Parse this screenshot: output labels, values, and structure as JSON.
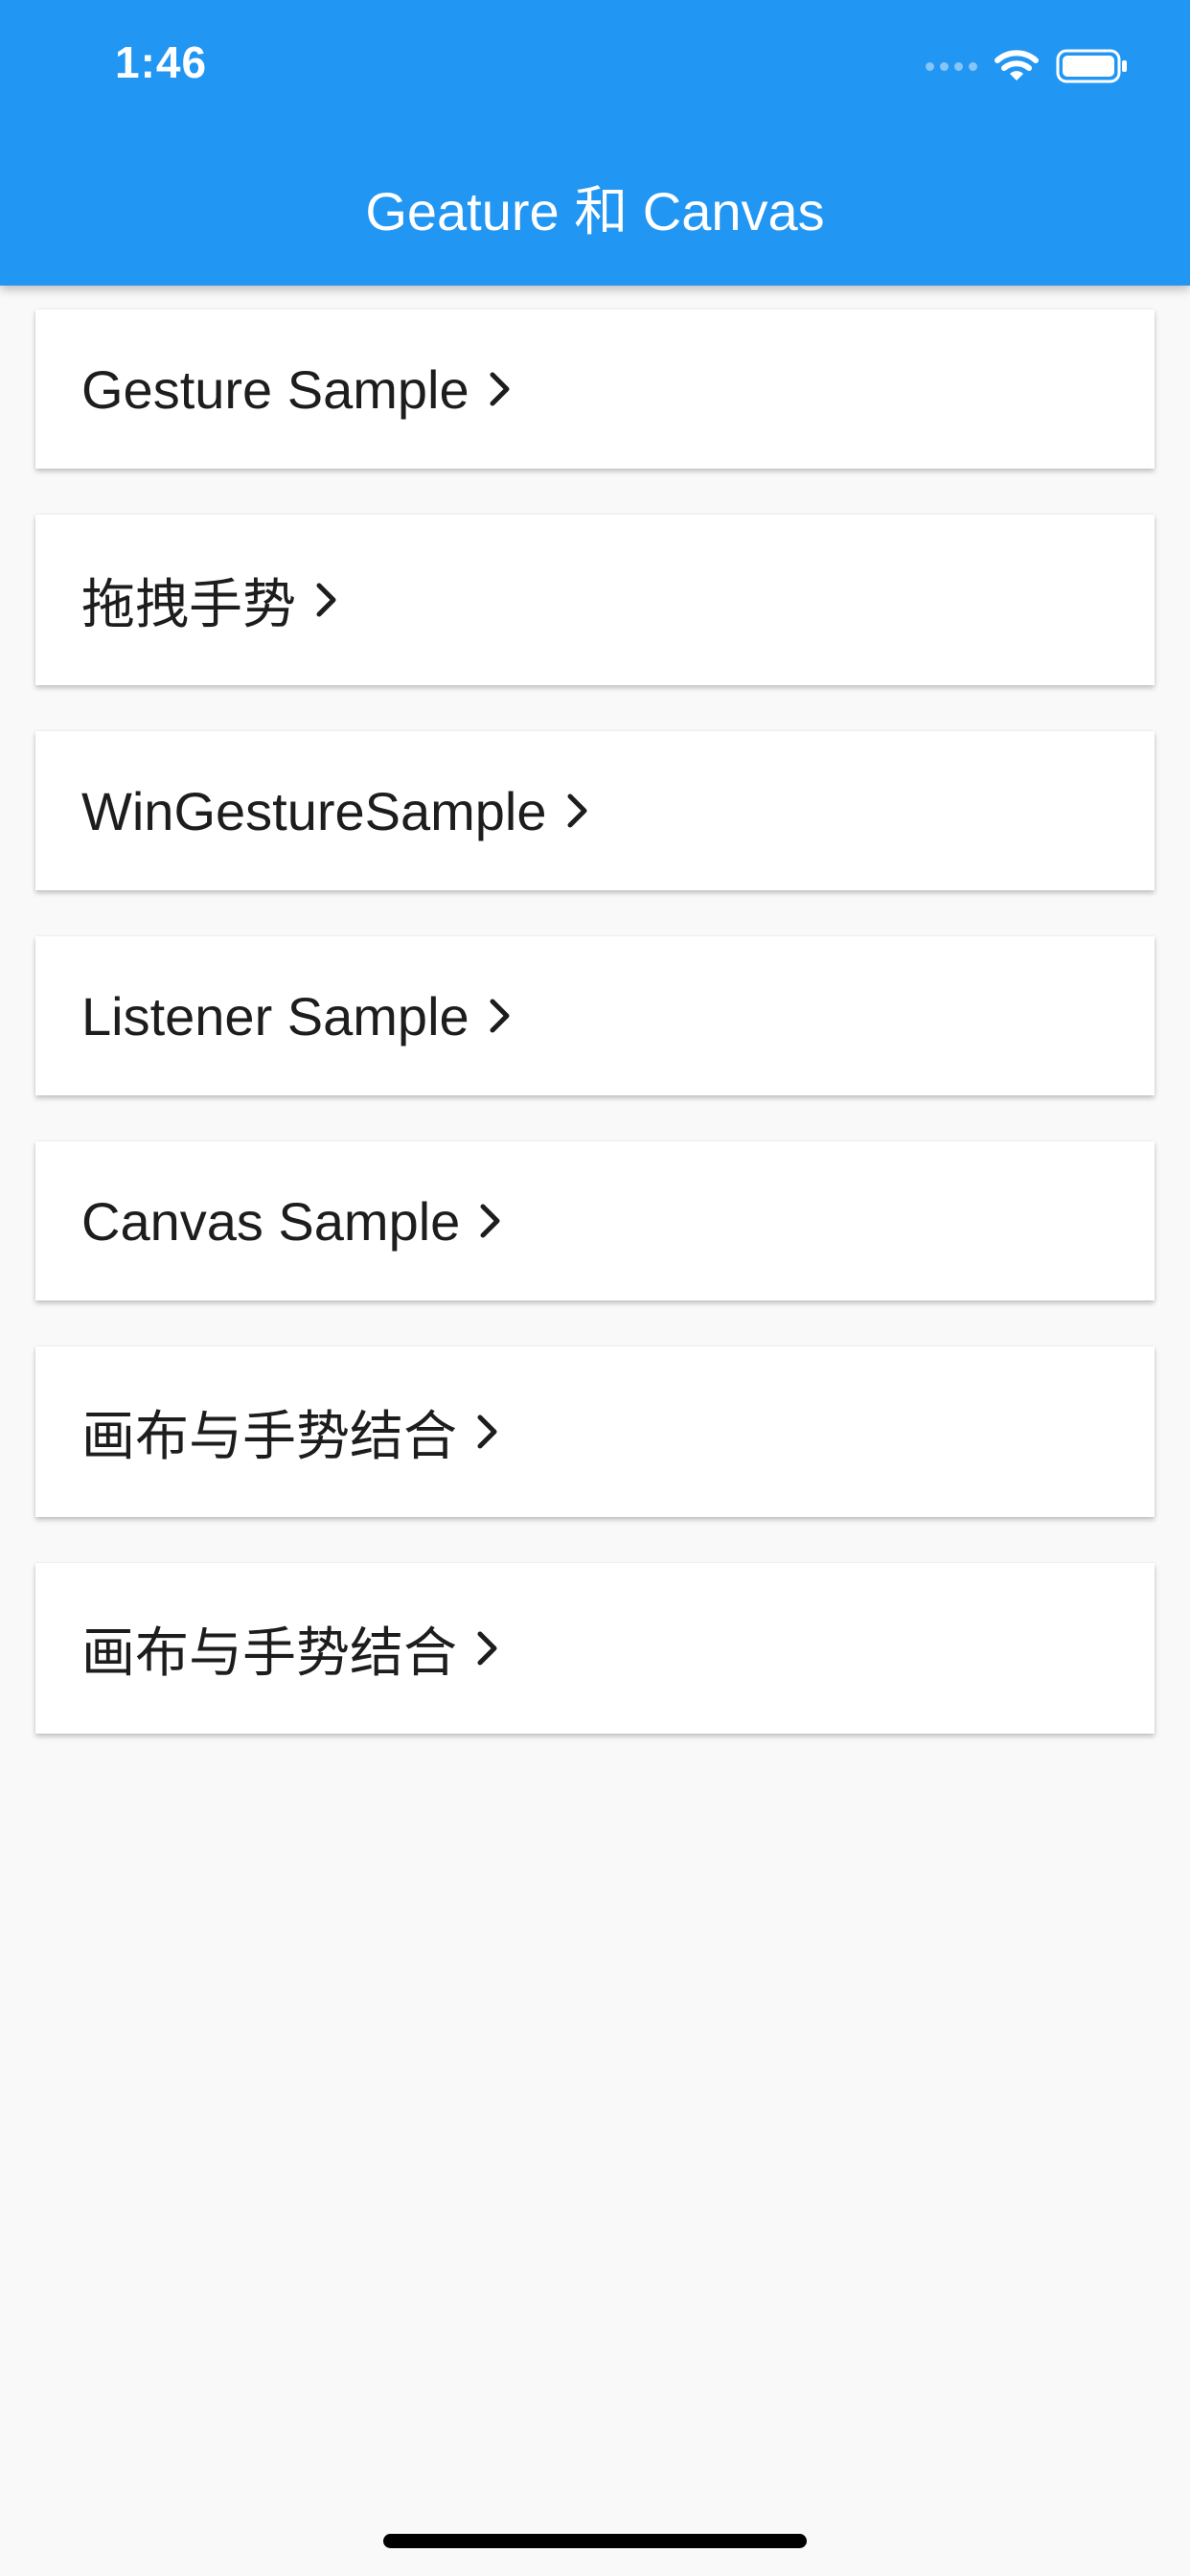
{
  "status_bar": {
    "time": "1:46"
  },
  "app_bar": {
    "title": "Geature 和 Canvas",
    "background_color": "#2296f3"
  },
  "menu": {
    "items": [
      {
        "label": "Gesture Sample"
      },
      {
        "label": "拖拽手势"
      },
      {
        "label": "WinGestureSample"
      },
      {
        "label": "Listener Sample"
      },
      {
        "label": "Canvas Sample"
      },
      {
        "label": "画布与手势结合"
      },
      {
        "label": "画布与手势结合"
      }
    ]
  },
  "icons": {
    "chevron": "chevron-right-icon",
    "wifi": "wifi-icon",
    "battery": "battery-icon",
    "signal": "cellular-signal-icon"
  }
}
